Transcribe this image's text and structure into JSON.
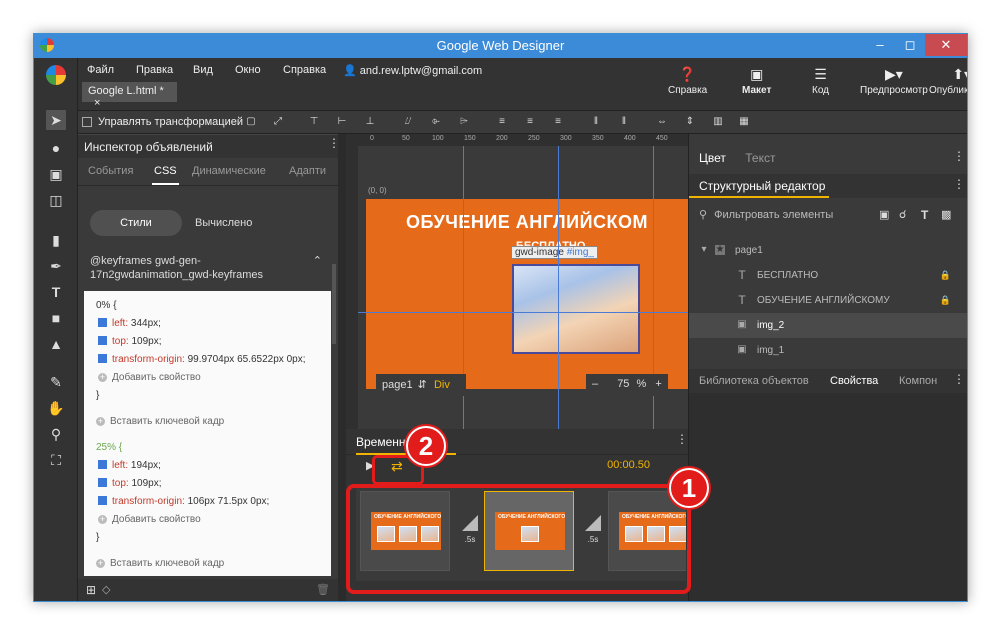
{
  "window": {
    "title": "Google Web Designer"
  },
  "menu": [
    "Файл",
    "Правка",
    "Вид",
    "Окно",
    "Справка"
  ],
  "account": "and.rew.lptw@gmail.com",
  "doc_tab": "Google L.html *",
  "doc_tab_close": "×",
  "top_buttons": {
    "help": "Справка",
    "layout": "Макет",
    "code": "Код",
    "preview": "Предпросмотр",
    "publish": "Опубликовать"
  },
  "toolbar": {
    "transform_label": "Управлять трансформацией"
  },
  "inspector": {
    "title": "Инспектор объявлений",
    "tabs": [
      "События",
      "CSS",
      "Динамические",
      "Адапти"
    ],
    "active_tab": "CSS",
    "segment_on": "Стили",
    "segment_off": "Вычислено",
    "keyframes_name": "@keyframes gwd-gen-17n2gwdanimation_gwd-keyframes",
    "frames": [
      {
        "pct": "0% {",
        "props": [
          {
            "name": "left:",
            "value": "344px;"
          },
          {
            "name": "top:",
            "value": "109px;"
          },
          {
            "name": "transform-origin:",
            "value": "99.9704px 65.6522px 0px;"
          }
        ]
      },
      {
        "pct": "25% {",
        "props": [
          {
            "name": "left:",
            "value": "194px;"
          },
          {
            "name": "top:",
            "value": "109px;"
          },
          {
            "name": "transform-origin:",
            "value": "106px 71.5px 0px;"
          }
        ]
      }
    ],
    "add_property": "Добавить свойство",
    "close_brace": "}",
    "insert_keyframe": "Вставить ключевой кадр"
  },
  "stage": {
    "coord": "(0, 0)",
    "heading": "ОБУЧЕНИЕ АНГЛИЙСКОМ",
    "subheading": "БЕСПЛАТНО",
    "element_label": "gwd-image",
    "element_id": "#img_",
    "page_selector": "page1",
    "element_type": "Div",
    "zoom": "75",
    "zoom_unit": "%",
    "ruler_ticks": [
      "0",
      "50",
      "100",
      "150",
      "200",
      "250",
      "300",
      "350",
      "400",
      "450"
    ]
  },
  "timeline": {
    "title": "Временна",
    "time": "00:00.50",
    "transitions": [
      ".5s",
      ".5s"
    ],
    "thumb_text": "ОБУЧЕНИЕ АНГЛИЙСКОГО"
  },
  "right": {
    "tab_color": "Цвет",
    "tab_text": "Текст",
    "structure_title": "Структурный редактор",
    "filter_placeholder": "Фильтровать элементы",
    "tree": [
      {
        "label": "page1"
      },
      {
        "label": "БЕСПЛАТНО"
      },
      {
        "label": "ОБУЧЕНИЕ АНГЛИЙСКОМУ"
      },
      {
        "label": "img_2"
      },
      {
        "label": "img_1"
      }
    ],
    "bottom_tabs": [
      "Библиотека объектов",
      "Свойства",
      "Компон"
    ]
  },
  "annotations": {
    "badge1": "1",
    "badge2": "2"
  },
  "colors": {
    "accent": "#f0b400",
    "stage": "#e56a1a",
    "highlight": "#e21b1b",
    "titlebar": "#3c8bd9"
  }
}
